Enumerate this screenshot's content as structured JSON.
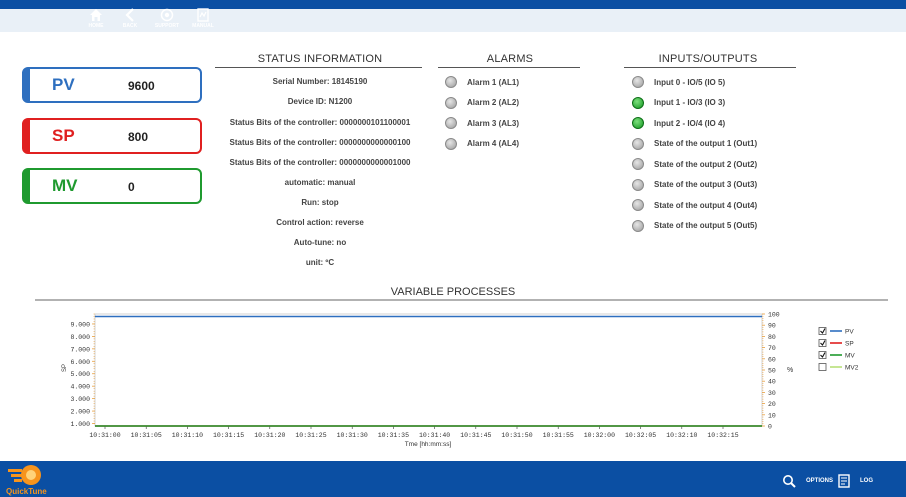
{
  "cards": {
    "pv": {
      "label": "PV",
      "value": "9600"
    },
    "sp": {
      "label": "SP",
      "value": "800"
    },
    "mv": {
      "label": "MV",
      "value": "0"
    }
  },
  "status": {
    "title": "STATUS INFORMATION",
    "lines": [
      "Serial Number: 18145190",
      "Device ID: N1200",
      "Status Bits of the controller: 0000000101100001",
      "Status Bits of the controller: 0000000000000100",
      "Status Bits of the controller: 0000000000001000",
      "automatic: manual",
      "Run: stop",
      "Control action: reverse",
      "Auto-tune: no",
      "unit: ºC"
    ]
  },
  "alarms": {
    "title": "ALARMS",
    "items": [
      {
        "label": "Alarm 1 (AL1)",
        "on": false
      },
      {
        "label": "Alarm 2 (AL2)",
        "on": false
      },
      {
        "label": "Alarm 3 (AL3)",
        "on": false
      },
      {
        "label": "Alarm 4 (AL4)",
        "on": false
      }
    ]
  },
  "io": {
    "title": "INPUTS/OUTPUTS",
    "items": [
      {
        "label": "Input 0 - IO/5 (IO 5)",
        "on": false
      },
      {
        "label": "Input 1 - IO/3 (IO 3)",
        "on": true
      },
      {
        "label": "Input 2 - IO/4 (IO 4)",
        "on": true
      },
      {
        "label": "State of the output 1 (Out1)",
        "on": false
      },
      {
        "label": "State of the output 2 (Out2)",
        "on": false
      },
      {
        "label": "State of the output 3 (Out3)",
        "on": false
      },
      {
        "label": "State of the output 4 (Out4)",
        "on": false
      },
      {
        "label": "State of the output 5 (Out5)",
        "on": false
      }
    ]
  },
  "chart_data": {
    "type": "line",
    "title": "VARIABLE PROCESSES",
    "xlabel": "Tme [hh:mm:ss]",
    "ylabel": "SP",
    "y2label": "%",
    "x": [
      "10:31:00",
      "10:31:05",
      "10:31:10",
      "10:31:15",
      "10:31:20",
      "10:31:25",
      "10:31:30",
      "10:31:35",
      "10:31:40",
      "10:31:45",
      "10:31:50",
      "10:31:55",
      "10:32:00",
      "10:32:05",
      "10:32:10",
      "10:32:15"
    ],
    "yticks": [
      "1.000",
      "2.000",
      "3.000",
      "4.000",
      "5.000",
      "6.000",
      "7.000",
      "8.000",
      "9.000"
    ],
    "y2ticks": [
      "0",
      "10",
      "20",
      "30",
      "40",
      "50",
      "60",
      "70",
      "80",
      "90",
      "100"
    ],
    "ylim": [
      800,
      9800
    ],
    "y2lim": [
      0,
      100
    ],
    "series": [
      {
        "name": "PV",
        "color": "#2e6fbf",
        "checked": true,
        "axis": "left",
        "values": [
          9600,
          9600,
          9600,
          9600,
          9600,
          9600,
          9600,
          9600,
          9600,
          9600,
          9600,
          9600,
          9600,
          9600,
          9600,
          9600
        ]
      },
      {
        "name": "SP",
        "color": "#e02020",
        "checked": true,
        "axis": "left",
        "values": [
          800,
          800,
          800,
          800,
          800,
          800,
          800,
          800,
          800,
          800,
          800,
          800,
          800,
          800,
          800,
          800
        ]
      },
      {
        "name": "MV",
        "color": "#1f9a2f",
        "checked": true,
        "axis": "right",
        "values": [
          0,
          0,
          0,
          0,
          0,
          0,
          0,
          0,
          0,
          0,
          0,
          0,
          0,
          0,
          0,
          0
        ]
      },
      {
        "name": "MV2",
        "color": "#b7e07a",
        "checked": false,
        "axis": "right",
        "values": []
      }
    ],
    "legend": "right"
  },
  "nav": {
    "logo_text": "QuickTune",
    "home": "HOME",
    "back": "BACK",
    "support": "SUPPORT",
    "manual": "MANUAL",
    "options": "OPTIONS",
    "log": "LOG"
  }
}
